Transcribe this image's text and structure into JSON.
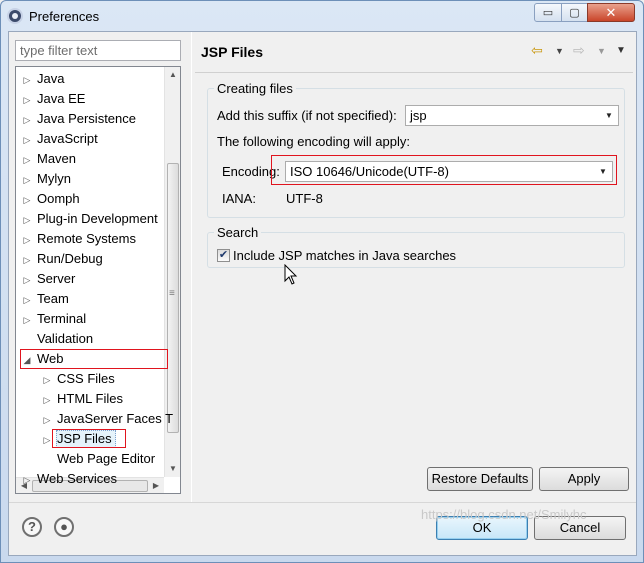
{
  "window": {
    "title": "Preferences",
    "minimize_glyph": "▭",
    "maximize_glyph": "▢",
    "close_glyph": "✕"
  },
  "filter": {
    "placeholder": "type filter text"
  },
  "tree": {
    "items": [
      {
        "label": "Java",
        "arrow": "▷",
        "level": 0
      },
      {
        "label": "Java EE",
        "arrow": "▷",
        "level": 0
      },
      {
        "label": "Java Persistence",
        "arrow": "▷",
        "level": 0
      },
      {
        "label": "JavaScript",
        "arrow": "▷",
        "level": 0
      },
      {
        "label": "Maven",
        "arrow": "▷",
        "level": 0
      },
      {
        "label": "Mylyn",
        "arrow": "▷",
        "level": 0
      },
      {
        "label": "Oomph",
        "arrow": "▷",
        "level": 0
      },
      {
        "label": "Plug-in Development",
        "arrow": "▷",
        "level": 0
      },
      {
        "label": "Remote Systems",
        "arrow": "▷",
        "level": 0
      },
      {
        "label": "Run/Debug",
        "arrow": "▷",
        "level": 0
      },
      {
        "label": "Server",
        "arrow": "▷",
        "level": 0
      },
      {
        "label": "Team",
        "arrow": "▷",
        "level": 0
      },
      {
        "label": "Terminal",
        "arrow": "▷",
        "level": 0
      },
      {
        "label": "Validation",
        "arrow": "",
        "level": 0
      },
      {
        "label": "Web",
        "arrow": "◢",
        "level": 0
      },
      {
        "label": "CSS Files",
        "arrow": "▷",
        "level": 1
      },
      {
        "label": "HTML Files",
        "arrow": "▷",
        "level": 1
      },
      {
        "label": "JavaServer Faces T",
        "arrow": "▷",
        "level": 1
      },
      {
        "label": "JSP Files",
        "arrow": "▷",
        "level": 1
      },
      {
        "label": "Web Page Editor",
        "arrow": "",
        "level": 1
      },
      {
        "label": "Web Services",
        "arrow": "▷",
        "level": 0
      }
    ],
    "selected": "JSP Files"
  },
  "page": {
    "title": "JSP Files",
    "creating_group": "Creating files",
    "suffix_label": "Add this suffix (if not specified):",
    "suffix_value": "jsp",
    "encoding_note": "The following encoding will apply:",
    "encoding_label": "Encoding:",
    "encoding_value": "ISO 10646/Unicode(UTF-8)",
    "iana_label": "IANA:",
    "iana_value": "UTF-8",
    "search_group": "Search",
    "include_label": "Include JSP matches in Java searches",
    "include_checked": true
  },
  "buttons": {
    "restore_defaults": "Restore Defaults",
    "apply": "Apply",
    "ok": "OK",
    "cancel": "Cancel"
  },
  "watermark": "https://blog.csdn.net/Smilyhc",
  "colors": {
    "highlight_box": "#e0141e",
    "nav_arrow": "#c9960c"
  }
}
